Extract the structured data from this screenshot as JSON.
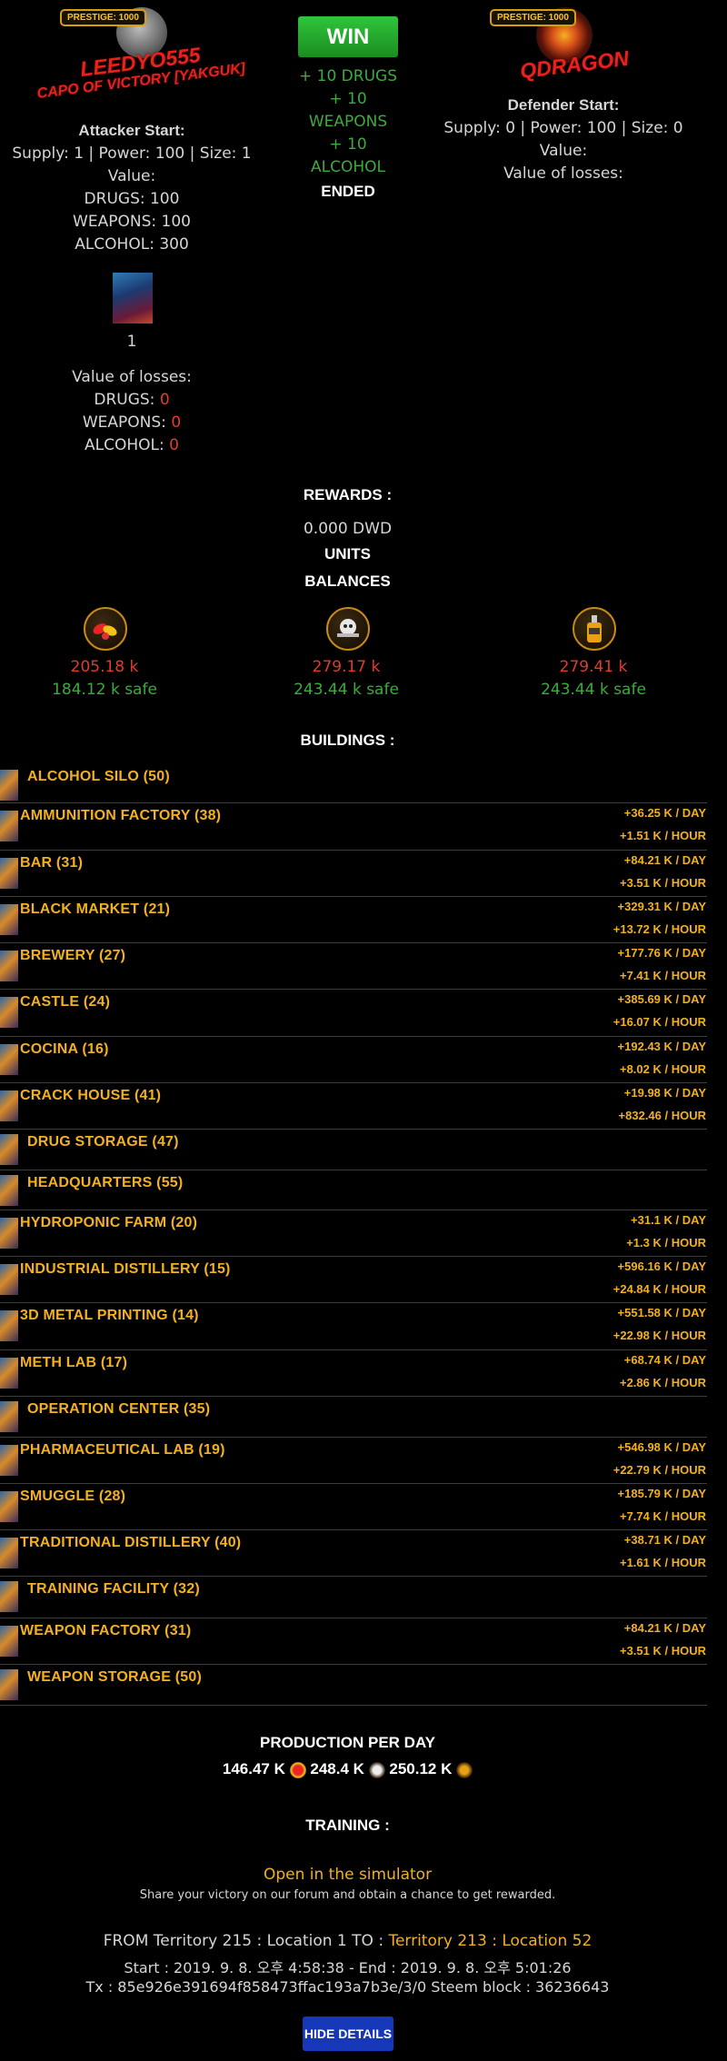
{
  "attacker": {
    "prestige": "PRESTIGE: 1000",
    "name": "LEEDYO555",
    "title": "CAPO OF VICTORY [YAKGUK]",
    "start_label": "Attacker Start:",
    "stats": "Supply: 1 | Power: 100 | Size: 1",
    "value_label": "Value:",
    "drugs": "DRUGS: 100",
    "weapons": "WEAPONS: 100",
    "alcohol": "ALCOHOL: 300",
    "unit_count": "1",
    "losses_label": "Value of losses:",
    "loss_drugs_label": "DRUGS:",
    "loss_drugs_val": "0",
    "loss_weapons_label": "WEAPONS:",
    "loss_weapons_val": "0",
    "loss_alcohol_label": "ALCOHOL:",
    "loss_alcohol_val": "0"
  },
  "result": {
    "button": "WIN",
    "line1": "+ 10 DRUGS",
    "line2": "+ 10",
    "line3": "WEAPONS",
    "line4": "+ 10",
    "line5": "ALCOHOL",
    "status": "ENDED"
  },
  "defender": {
    "prestige": "PRESTIGE: 1000",
    "name": "QDRAGON",
    "start_label": "Defender Start:",
    "stats": "Supply: 0 | Power: 100 | Size: 0",
    "value_label": "Value:",
    "losses_label": "Value of losses:"
  },
  "rewards": {
    "heading": "REWARDS :",
    "dwd": "0.000 DWD",
    "units": "UNITS",
    "balances": "BALANCES"
  },
  "balances": [
    {
      "icon": "drugs-pills-icon",
      "amount": "205.18 k",
      "safe": "184.12 k safe"
    },
    {
      "icon": "weapons-skull-gun-icon",
      "amount": "279.17 k",
      "safe": "243.44 k safe"
    },
    {
      "icon": "alcohol-bottle-icon",
      "amount": "279.41 k",
      "safe": "243.44 k safe"
    }
  ],
  "buildings_heading": "BUILDINGS :",
  "buildings": [
    {
      "name": "ALCOHOL SILO (50)",
      "day": "",
      "hour": ""
    },
    {
      "name": "AMMUNITION FACTORY (38)",
      "day": "+36.25 K / DAY",
      "hour": "+1.51 K / HOUR"
    },
    {
      "name": "BAR (31)",
      "day": "+84.21 K / DAY",
      "hour": "+3.51 K / HOUR"
    },
    {
      "name": "BLACK MARKET (21)",
      "day": "+329.31 K / DAY",
      "hour": "+13.72 K / HOUR"
    },
    {
      "name": "BREWERY (27)",
      "day": "+177.76 K / DAY",
      "hour": "+7.41 K / HOUR"
    },
    {
      "name": "CASTLE (24)",
      "day": "+385.69 K / DAY",
      "hour": "+16.07 K / HOUR"
    },
    {
      "name": "COCINA (16)",
      "day": "+192.43 K / DAY",
      "hour": "+8.02 K / HOUR"
    },
    {
      "name": "CRACK HOUSE (41)",
      "day": "+19.98 K / DAY",
      "hour": "+832.46 / HOUR"
    },
    {
      "name": "DRUG STORAGE (47)",
      "day": "",
      "hour": ""
    },
    {
      "name": "HEADQUARTERS (55)",
      "day": "",
      "hour": ""
    },
    {
      "name": "HYDROPONIC FARM (20)",
      "day": "+31.1 K / DAY",
      "hour": "+1.3 K / HOUR"
    },
    {
      "name": "INDUSTRIAL DISTILLERY (15)",
      "day": "+596.16 K / DAY",
      "hour": "+24.84 K / HOUR"
    },
    {
      "name": "3D METAL PRINTING (14)",
      "day": "+551.58 K / DAY",
      "hour": "+22.98 K / HOUR"
    },
    {
      "name": "METH LAB (17)",
      "day": "+68.74 K / DAY",
      "hour": "+2.86 K / HOUR"
    },
    {
      "name": "OPERATION CENTER (35)",
      "day": "",
      "hour": ""
    },
    {
      "name": "PHARMACEUTICAL LAB (19)",
      "day": "+546.98 K / DAY",
      "hour": "+22.79 K / HOUR"
    },
    {
      "name": "SMUGGLE (28)",
      "day": "+185.79 K / DAY",
      "hour": "+7.74 K / HOUR"
    },
    {
      "name": "TRADITIONAL DISTILLERY (40)",
      "day": "+38.71 K / DAY",
      "hour": "+1.61 K / HOUR"
    },
    {
      "name": "TRAINING FACILITY (32)",
      "day": "",
      "hour": ""
    },
    {
      "name": "WEAPON FACTORY (31)",
      "day": "+84.21 K / DAY",
      "hour": "+3.51 K / HOUR"
    },
    {
      "name": "WEAPON STORAGE (50)",
      "day": "",
      "hour": ""
    }
  ],
  "production": {
    "heading": "PRODUCTION PER DAY",
    "drugs": "146.47 K",
    "weapons": "248.4 K",
    "alcohol": "250.12 K"
  },
  "training_heading": "TRAINING :",
  "simulator_link": "Open in the simulator",
  "share_text": "Share your victory on our forum and obtain a chance to get rewarded.",
  "footer": {
    "from": "FROM Territory 215 : Location 1 TO :",
    "to_territory": "Territory 213",
    "colon": ":",
    "to_location": "Location 52",
    "time": "Start : 2019. 9. 8. 오후 4:58:38 - End : 2019. 9. 8. 오후 5:01:26",
    "tx": "Tx : 85e926e391694f858473ffac193a7b3e/3/0 Steem block : 36236643"
  },
  "hide_button": "HIDE DETAILS",
  "colors": {
    "accent": "#f3b01f",
    "win": "#22a52b",
    "loss": "#e23b2a",
    "safe": "#3eaa3e",
    "button": "#1638b8"
  }
}
